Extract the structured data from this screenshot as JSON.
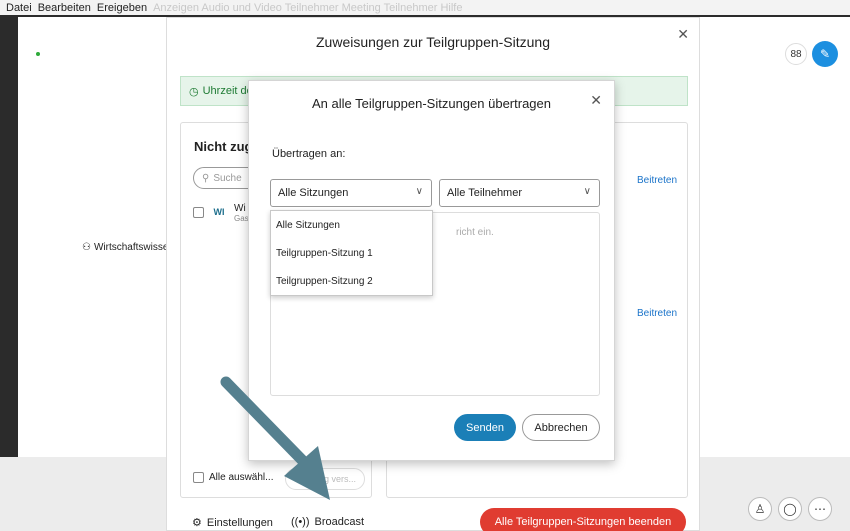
{
  "menubar": {
    "items": [
      "Datei",
      "Bearbeiten",
      "Ereigeben"
    ],
    "ghost": "Anzeigen  Audio und Video  Teilnehmer  Meeting  Teilnehmer  Hilfe"
  },
  "meeting": {
    "left_label": "Wirtschaftswisse",
    "layout_icon": "88"
  },
  "outer_dialog": {
    "title": "Zuweisungen zur Teilgruppen-Sitzung",
    "info": "Uhrzeit de",
    "unassigned_title": "Nicht zug",
    "search_placeholder": "Suche",
    "user_initials": "WI",
    "user_name": "Wi",
    "user_role": "Gas",
    "join_label_1": "Beitreten",
    "join_label_2": "Beitreten",
    "select_all": "Alle auswähl...",
    "move_button": "g vers...",
    "settings": "Einstellungen",
    "broadcast": "Broadcast",
    "end_all": "Alle Teilgruppen-Sitzungen beenden"
  },
  "broadcast_dialog": {
    "title": "An alle Teilgruppen-Sitzungen übertragen",
    "to_label": "Übertragen an:",
    "sessions_selected": "Alle Sitzungen",
    "participants_selected": "Alle Teilnehmer",
    "message_placeholder": "richt ein.",
    "dropdown_options": [
      "Alle Sitzungen",
      "Teilgruppen-Sitzung 1",
      "Teilgruppen-Sitzung 2"
    ],
    "send": "Senden",
    "cancel": "Abbrechen"
  },
  "colors": {
    "primary_button": "#1b7fb7",
    "danger_button": "#e03c31",
    "link": "#1a73c9",
    "info_bg": "#e6f4ea",
    "annotation_arrow": "#55808f"
  }
}
